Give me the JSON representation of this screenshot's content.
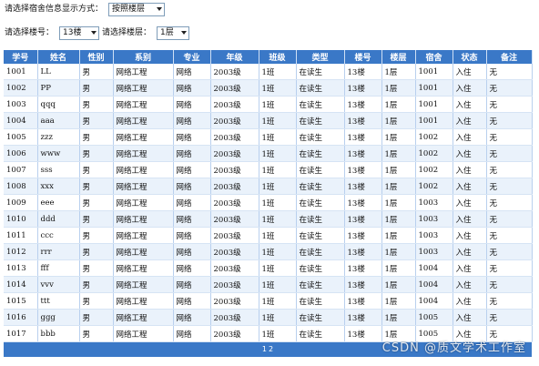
{
  "filters": {
    "mode_label": "请选择宿舍信息显示方式：",
    "mode_value": "按照楼层",
    "building_label": "请选择楼号：",
    "building_value": "13楼",
    "floor_label": "请选择楼层：",
    "floor_value": "1层"
  },
  "table": {
    "headers": [
      "学号",
      "姓名",
      "性别",
      "系别",
      "专业",
      "年级",
      "班级",
      "类型",
      "楼号",
      "楼层",
      "宿舍",
      "状态",
      "备注"
    ],
    "rows": [
      [
        "1001",
        "LL",
        "男",
        "网络工程",
        "网络",
        "2003级",
        "1班",
        "在读生",
        "13楼",
        "1层",
        "1001",
        "入住",
        "无"
      ],
      [
        "1002",
        "PP",
        "男",
        "网络工程",
        "网络",
        "2003级",
        "1班",
        "在读生",
        "13楼",
        "1层",
        "1001",
        "入住",
        "无"
      ],
      [
        "1003",
        "qqq",
        "男",
        "网络工程",
        "网络",
        "2003级",
        "1班",
        "在读生",
        "13楼",
        "1层",
        "1001",
        "入住",
        "无"
      ],
      [
        "1004",
        "aaa",
        "男",
        "网络工程",
        "网络",
        "2003级",
        "1班",
        "在读生",
        "13楼",
        "1层",
        "1001",
        "入住",
        "无"
      ],
      [
        "1005",
        "zzz",
        "男",
        "网络工程",
        "网络",
        "2003级",
        "1班",
        "在读生",
        "13楼",
        "1层",
        "1002",
        "入住",
        "无"
      ],
      [
        "1006",
        "www",
        "男",
        "网络工程",
        "网络",
        "2003级",
        "1班",
        "在读生",
        "13楼",
        "1层",
        "1002",
        "入住",
        "无"
      ],
      [
        "1007",
        "sss",
        "男",
        "网络工程",
        "网络",
        "2003级",
        "1班",
        "在读生",
        "13楼",
        "1层",
        "1002",
        "入住",
        "无"
      ],
      [
        "1008",
        "xxx",
        "男",
        "网络工程",
        "网络",
        "2003级",
        "1班",
        "在读生",
        "13楼",
        "1层",
        "1002",
        "入住",
        "无"
      ],
      [
        "1009",
        "eee",
        "男",
        "网络工程",
        "网络",
        "2003级",
        "1班",
        "在读生",
        "13楼",
        "1层",
        "1003",
        "入住",
        "无"
      ],
      [
        "1010",
        "ddd",
        "男",
        "网络工程",
        "网络",
        "2003级",
        "1班",
        "在读生",
        "13楼",
        "1层",
        "1003",
        "入住",
        "无"
      ],
      [
        "1011",
        "ccc",
        "男",
        "网络工程",
        "网络",
        "2003级",
        "1班",
        "在读生",
        "13楼",
        "1层",
        "1003",
        "入住",
        "无"
      ],
      [
        "1012",
        "rrr",
        "男",
        "网络工程",
        "网络",
        "2003级",
        "1班",
        "在读生",
        "13楼",
        "1层",
        "1003",
        "入住",
        "无"
      ],
      [
        "1013",
        "fff",
        "男",
        "网络工程",
        "网络",
        "2003级",
        "1班",
        "在读生",
        "13楼",
        "1层",
        "1004",
        "入住",
        "无"
      ],
      [
        "1014",
        "vvv",
        "男",
        "网络工程",
        "网络",
        "2003级",
        "1班",
        "在读生",
        "13楼",
        "1层",
        "1004",
        "入住",
        "无"
      ],
      [
        "1015",
        "ttt",
        "男",
        "网络工程",
        "网络",
        "2003级",
        "1班",
        "在读生",
        "13楼",
        "1层",
        "1004",
        "入住",
        "无"
      ],
      [
        "1016",
        "ggg",
        "男",
        "网络工程",
        "网络",
        "2003级",
        "1班",
        "在读生",
        "13楼",
        "1层",
        "1005",
        "入住",
        "无"
      ],
      [
        "1017",
        "bbb",
        "男",
        "网络工程",
        "网络",
        "2003级",
        "1班",
        "在读生",
        "13楼",
        "1层",
        "1005",
        "入住",
        "无"
      ]
    ]
  },
  "pager": {
    "pages": [
      "1",
      "2"
    ]
  },
  "watermark": "CSDN @质文学术工作室",
  "colors": {
    "header_bg": "#3a78c7",
    "row_alt_bg": "#eaf2fb"
  }
}
